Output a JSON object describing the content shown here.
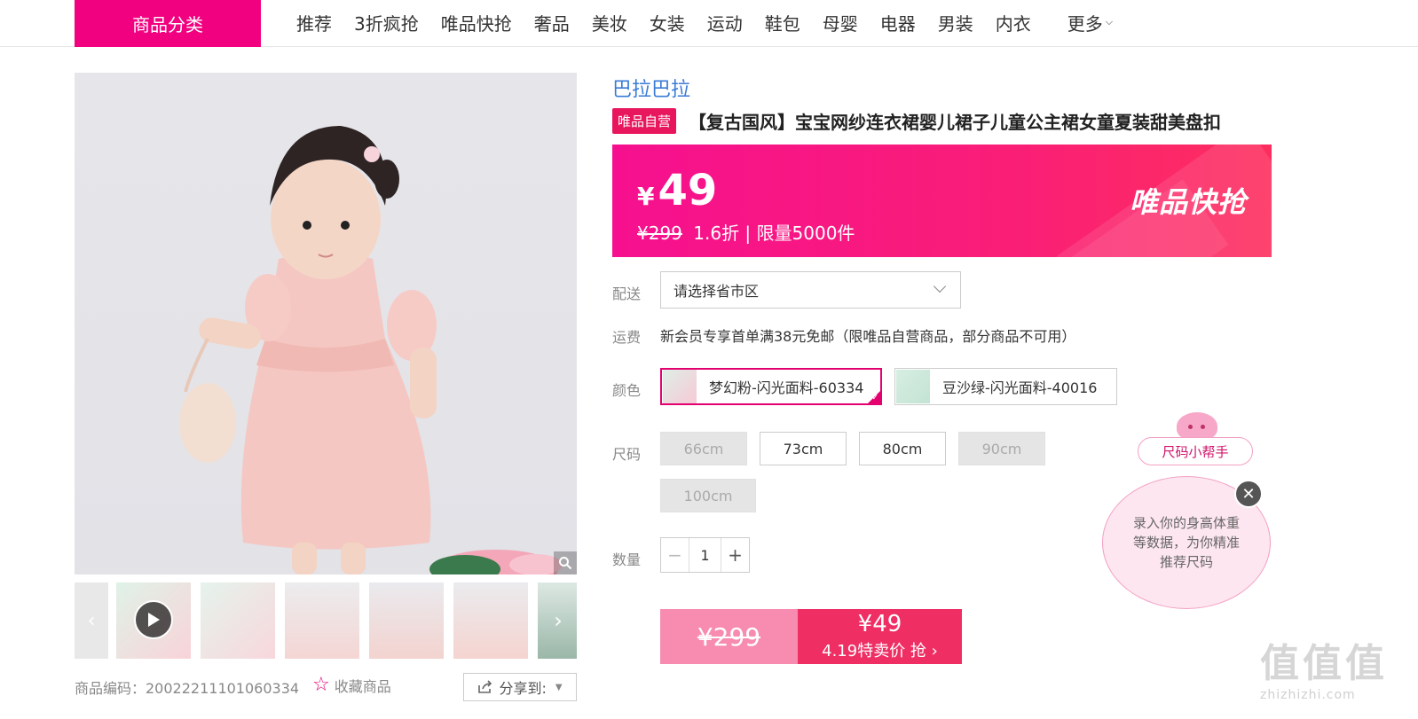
{
  "nav": {
    "category_label": "商品分类",
    "items": [
      "推荐",
      "3折疯抢",
      "唯品快抢",
      "奢品",
      "美妆",
      "女装",
      "运动",
      "鞋包",
      "母婴",
      "电器",
      "男装",
      "内衣"
    ],
    "more_label": "更多"
  },
  "gallery": {
    "prev_icon": "‹",
    "next_icon": "›"
  },
  "product": {
    "sku_line": "商品编码：20022211101060334",
    "favorite_label": "收藏商品",
    "share_label": "分享到:",
    "brand": "巴拉巴拉",
    "self_badge": "唯品自营",
    "title": "【复古国风】宝宝网纱连衣裙婴儿裙子儿童公主裙女童夏装甜美盘扣"
  },
  "price": {
    "currency": "¥",
    "current": "49",
    "original": "¥299",
    "discount_limit": "1.6折 | 限量5000件",
    "banner_tag": "唯品快抢"
  },
  "delivery": {
    "label": "配送",
    "placeholder": "请选择省市区"
  },
  "shipping": {
    "label": "运费",
    "text": "新会员专享首单满38元免邮（限唯品自营商品，部分商品不可用）"
  },
  "color": {
    "label": "颜色",
    "options": [
      "梦幻粉-闪光面料-60334",
      "豆沙绿-闪光面料-40016"
    ],
    "selected_index": 0
  },
  "size": {
    "label": "尺码",
    "options": [
      "66cm",
      "73cm",
      "80cm",
      "90cm",
      "100cm"
    ],
    "disabled": [
      "66cm",
      "90cm",
      "100cm"
    ]
  },
  "quantity": {
    "label": "数量",
    "value": "1",
    "minus": "−",
    "plus": "+"
  },
  "buy": {
    "old_price": "¥299",
    "new_price": "¥49",
    "promo_text": "4.19特卖价 抢 ›"
  },
  "size_helper": {
    "pill_label": "尺码小帮手",
    "bubble_text": "录入你的身高体重等数据，为你精准推荐尺码",
    "close_icon": "✕"
  },
  "watermark": {
    "big": "值值值",
    "small": "zhizhizhi.com"
  },
  "colors": {
    "accent": "#f10180",
    "brand_link": "#3a7bd5",
    "buy_right": "#ef2e64",
    "buy_left": "#f78bb0"
  }
}
